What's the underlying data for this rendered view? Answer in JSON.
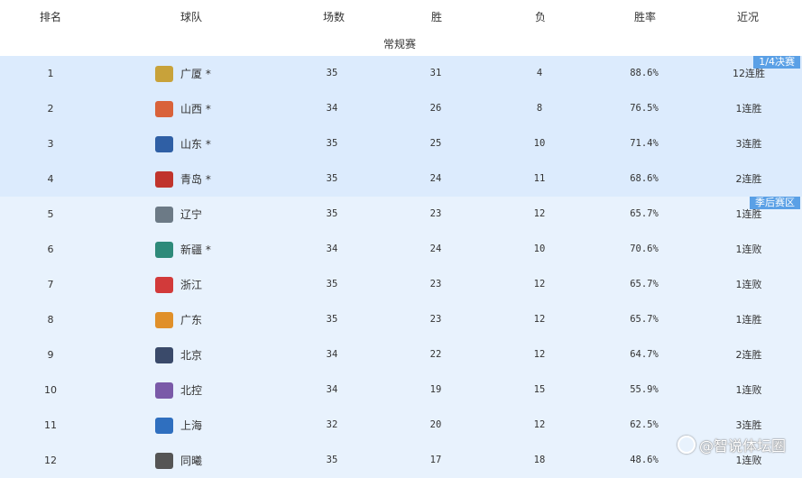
{
  "headers": {
    "rank": "排名",
    "team": "球队",
    "games": "场数",
    "wins": "胜",
    "losses": "负",
    "pct": "胜率",
    "recent": "近况"
  },
  "section_title": "常规赛",
  "badges": {
    "quarterfinal": "1/4决赛",
    "playoff": "季后赛区"
  },
  "rows": [
    {
      "rank": "1",
      "team": "广厦 *",
      "games": "35",
      "wins": "31",
      "losses": "4",
      "pct": "88.6%",
      "recent": "12连胜",
      "logo_color": "#c8a23a"
    },
    {
      "rank": "2",
      "team": "山西 *",
      "games": "34",
      "wins": "26",
      "losses": "8",
      "pct": "76.5%",
      "recent": "1连胜",
      "logo_color": "#d9623a"
    },
    {
      "rank": "3",
      "team": "山东 *",
      "games": "35",
      "wins": "25",
      "losses": "10",
      "pct": "71.4%",
      "recent": "3连胜",
      "logo_color": "#2f5fa5"
    },
    {
      "rank": "4",
      "team": "青岛 *",
      "games": "35",
      "wins": "24",
      "losses": "11",
      "pct": "68.6%",
      "recent": "2连胜",
      "logo_color": "#c0342c"
    },
    {
      "rank": "5",
      "team": "辽宁",
      "games": "35",
      "wins": "23",
      "losses": "12",
      "pct": "65.7%",
      "recent": "1连胜",
      "logo_color": "#6c7a86"
    },
    {
      "rank": "6",
      "team": "新疆 *",
      "games": "34",
      "wins": "24",
      "losses": "10",
      "pct": "70.6%",
      "recent": "1连败",
      "logo_color": "#2e8a7a"
    },
    {
      "rank": "7",
      "team": "浙江",
      "games": "35",
      "wins": "23",
      "losses": "12",
      "pct": "65.7%",
      "recent": "1连败",
      "logo_color": "#d23a3a"
    },
    {
      "rank": "8",
      "team": "广东",
      "games": "35",
      "wins": "23",
      "losses": "12",
      "pct": "65.7%",
      "recent": "1连胜",
      "logo_color": "#e0902a"
    },
    {
      "rank": "9",
      "team": "北京",
      "games": "34",
      "wins": "22",
      "losses": "12",
      "pct": "64.7%",
      "recent": "2连胜",
      "logo_color": "#3a4a6a"
    },
    {
      "rank": "10",
      "team": "北控",
      "games": "34",
      "wins": "19",
      "losses": "15",
      "pct": "55.9%",
      "recent": "1连败",
      "logo_color": "#7a5aa8"
    },
    {
      "rank": "11",
      "team": "上海",
      "games": "32",
      "wins": "20",
      "losses": "12",
      "pct": "62.5%",
      "recent": "3连胜",
      "logo_color": "#2f6fbf"
    },
    {
      "rank": "12",
      "team": "同曦",
      "games": "35",
      "wins": "17",
      "losses": "18",
      "pct": "48.6%",
      "recent": "1连败",
      "logo_color": "#555555"
    }
  ],
  "watermark": "@智说体坛圈"
}
